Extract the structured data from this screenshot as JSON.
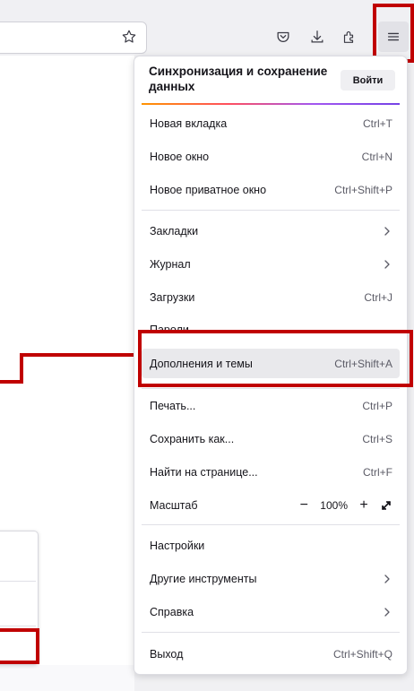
{
  "menu": {
    "sync": {
      "title": "Синхронизация и сохранение данных",
      "button": "Войти"
    },
    "items": [
      {
        "label": "Новая вкладка",
        "shortcut": "Ctrl+T"
      },
      {
        "label": "Новое окно",
        "shortcut": "Ctrl+N"
      },
      {
        "label": "Новое приватное окно",
        "shortcut": "Ctrl+Shift+P"
      },
      {
        "label": "Закладки"
      },
      {
        "label": "Журнал"
      },
      {
        "label": "Загрузки",
        "shortcut": "Ctrl+J"
      },
      {
        "label": "Пароли"
      },
      {
        "label": "Дополнения и темы",
        "shortcut": "Ctrl+Shift+A"
      },
      {
        "label": "Печать...",
        "shortcut": "Ctrl+P"
      },
      {
        "label": "Сохранить как...",
        "shortcut": "Ctrl+S"
      },
      {
        "label": "Найти на странице...",
        "shortcut": "Ctrl+F"
      },
      {
        "label": "Масштаб"
      },
      {
        "label": "Настройки"
      },
      {
        "label": "Другие инструменты"
      },
      {
        "label": "Справка"
      },
      {
        "label": "Выход",
        "shortcut": "Ctrl+Shift+Q"
      }
    ],
    "zoom": {
      "minus": "−",
      "value": "100%",
      "plus": "+"
    }
  },
  "toolbar": {
    "icons": [
      "star-icon",
      "pocket-icon",
      "download-icon",
      "extensions-icon",
      "hamburger-menu-icon"
    ]
  },
  "colors": {
    "annotation": "#c00000",
    "hover": "#e9e9ec",
    "accent_gradient": [
      "#ff9400",
      "#ff4f5e",
      "#a257f0",
      "#7542e5"
    ]
  }
}
